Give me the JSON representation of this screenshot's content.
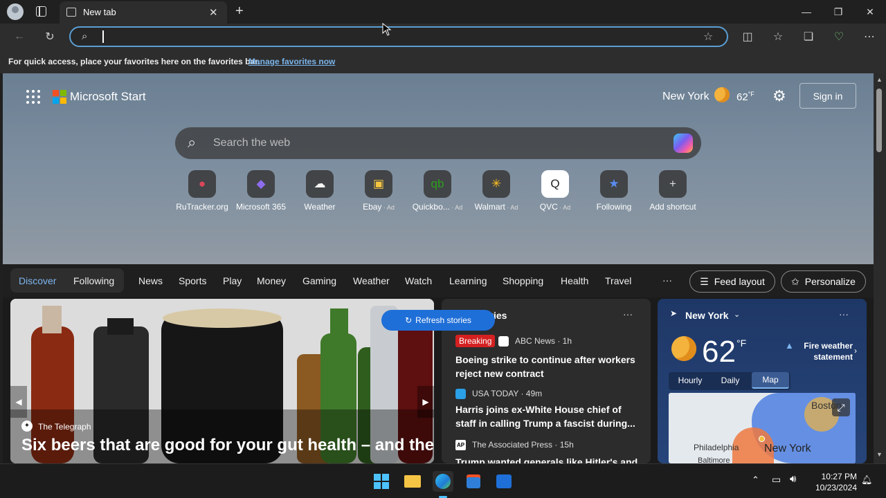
{
  "browser": {
    "tab_title": "New tab",
    "address_value": "",
    "favbar_text": "For quick access, place your favorites here on the favorites bar.",
    "favbar_link": "Manage favorites now"
  },
  "start": {
    "brand": "Microsoft Start",
    "location": "New York",
    "temp": "62",
    "temp_unit": "°F",
    "sign_in": "Sign in",
    "search_placeholder": "Search the web",
    "shortcuts": [
      {
        "label": "RuTracker.org",
        "ad": "",
        "icon": "rutracker-icon"
      },
      {
        "label": "Microsoft 365",
        "ad": "",
        "icon": "microsoft365-icon"
      },
      {
        "label": "Weather",
        "ad": "",
        "icon": "weather-cloud-icon"
      },
      {
        "label": "Ebay",
        "ad": "Ad",
        "icon": "ebay-bag-icon"
      },
      {
        "label": "Quickbo...",
        "ad": "Ad",
        "icon": "quickbooks-icon"
      },
      {
        "label": "Walmart",
        "ad": "Ad",
        "icon": "walmart-icon"
      },
      {
        "label": "QVC",
        "ad": "Ad",
        "icon": "qvc-icon"
      },
      {
        "label": "Following",
        "ad": "",
        "icon": "following-star-icon"
      },
      {
        "label": "Add shortcut",
        "ad": "",
        "icon": "plus-icon"
      }
    ]
  },
  "feed_nav": {
    "pill": [
      "Discover",
      "Following"
    ],
    "items": [
      "News",
      "Sports",
      "Play",
      "Money",
      "Gaming",
      "Weather",
      "Watch",
      "Learning",
      "Shopping",
      "Health",
      "Travel"
    ],
    "more": "···",
    "feed_layout": "Feed layout",
    "personalize": "Personalize"
  },
  "hero": {
    "source": "The Telegraph",
    "title": "Six beers that are good for your gut health – and the"
  },
  "top_stories": {
    "header": "Top stories",
    "refresh": "Refresh stories",
    "stories": [
      {
        "badge": "Breaking",
        "source": "ABC News · 1h",
        "title": "Boeing strike to continue after workers reject new contract"
      },
      {
        "badge": "",
        "source": "USA TODAY · 49m",
        "title": "Harris joins ex-White House chief of staff in calling Trump a fascist during..."
      },
      {
        "badge": "",
        "source": "The Associated Press · 15h",
        "title": "Trump wanted generals like Hitler's and..."
      }
    ]
  },
  "weather": {
    "city": "New York",
    "temp": "62",
    "unit": "°F",
    "alert": "Fire weather statement",
    "tabs": [
      "Hourly",
      "Daily",
      "Map"
    ],
    "selected_tab": "Map",
    "map_labels": [
      "Boston",
      "Philadelphia",
      "New York",
      "Baltimore"
    ]
  },
  "taskbar": {
    "time": "10:27 PM",
    "date": "10/23/2024"
  },
  "colors": {
    "accent": "#1f6fd8",
    "address_border": "#5a9fd4",
    "breaking": "#d42020",
    "discover": "#7eb6f0"
  }
}
